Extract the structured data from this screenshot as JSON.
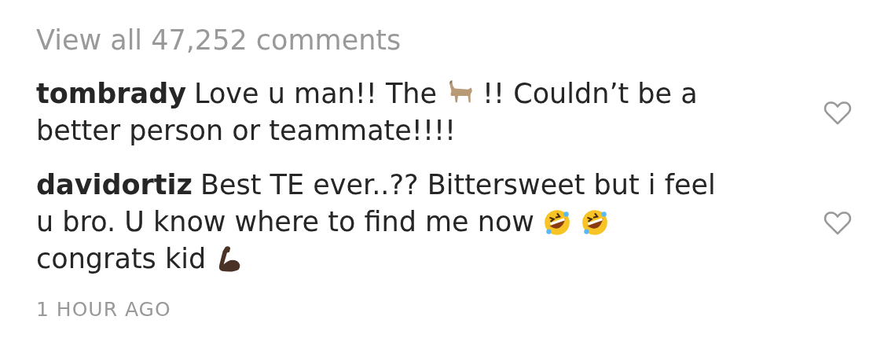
{
  "view_all_link": "View all 47,252 comments",
  "comments": [
    {
      "username": "tombrady",
      "liked": false,
      "lines": [
        [
          {
            "kind": "text",
            "text": "Love u man!! The"
          },
          {
            "kind": "goat"
          },
          {
            "kind": "text",
            "text": "!! Couldn’t be a"
          }
        ],
        [
          {
            "kind": "text",
            "text": "better person or teammate!!!!"
          }
        ]
      ]
    },
    {
      "username": "davidortiz",
      "liked": false,
      "lines": [
        [
          {
            "kind": "text",
            "text": "Best TE ever..?? Bittersweet but i feel"
          }
        ],
        [
          {
            "kind": "text",
            "text": "u bro. U know where to find me now"
          },
          {
            "kind": "laughing"
          },
          {
            "kind": "laughing"
          }
        ],
        [
          {
            "kind": "text",
            "text": "congrats kid"
          },
          {
            "kind": "flex"
          }
        ]
      ]
    }
  ],
  "timestamp": "1 HOUR AGO"
}
